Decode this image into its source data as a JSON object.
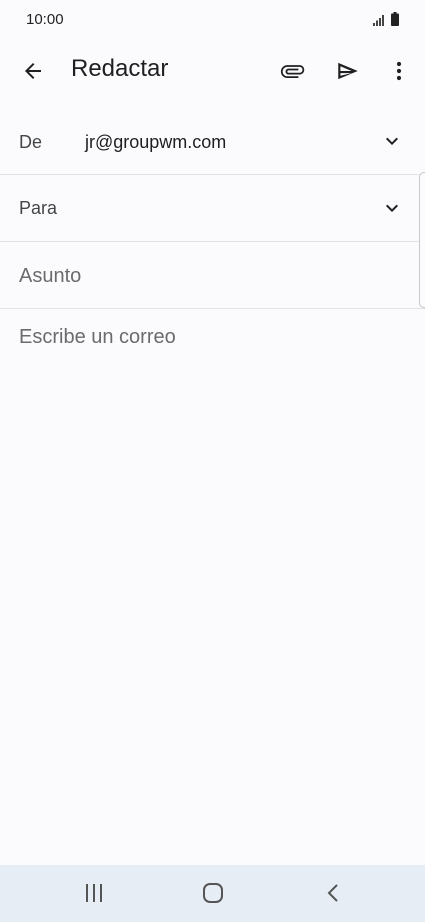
{
  "status_bar": {
    "time": "10:00",
    "icons": [
      "signal-icon",
      "battery-icon"
    ]
  },
  "app_bar": {
    "title": "Redactar",
    "icons": [
      "back-arrow-icon",
      "attachment-icon",
      "send-icon",
      "more-vert-icon"
    ]
  },
  "compose": {
    "from_label": "De",
    "from_value": "jr@groupwm.com",
    "to_label": "Para",
    "subject_placeholder": "Asunto",
    "body_placeholder": "Escribe un correo"
  },
  "nav_bar": {
    "icons": [
      "recents-icon",
      "home-icon",
      "nav-back-icon"
    ]
  },
  "colors": {
    "background": "#fbfbfe",
    "divider": "#e3e3e7",
    "nav_background": "#e6edf5",
    "icon": "#1f1f1f",
    "placeholder": "#6b6b6b"
  }
}
